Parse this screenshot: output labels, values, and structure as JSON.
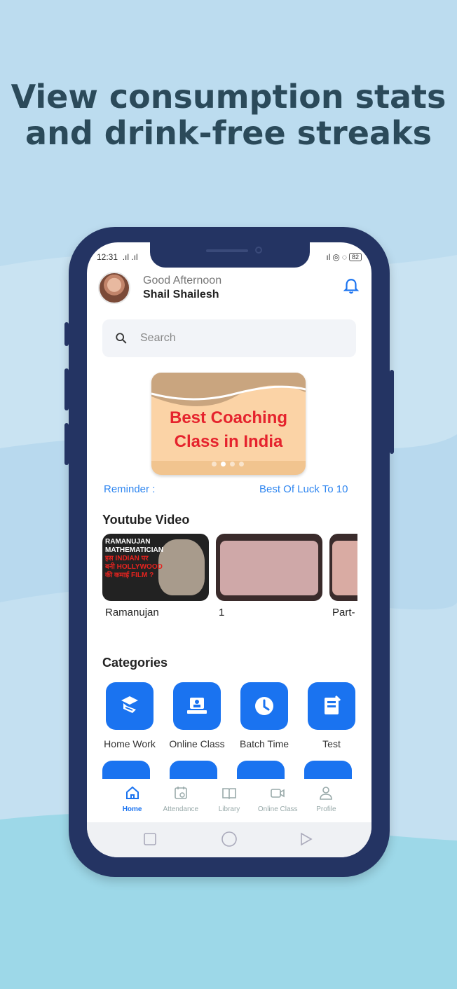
{
  "headline": [
    "View consumption stats",
    "and drink-free streaks"
  ],
  "status_bar": {
    "time": "12:31",
    "battery": "82"
  },
  "header": {
    "greeting": "Good Afternoon",
    "user_name": "Shail Shailesh",
    "avatar_icon": "user-avatar",
    "bell_icon": "bell-icon"
  },
  "search": {
    "placeholder": "Search"
  },
  "banner": {
    "line1": "Best Coaching",
    "line2": "Class in India",
    "dots": 4,
    "active_dot": 1
  },
  "reminder": {
    "label": "Reminder :",
    "message": "Best Of Luck To 10"
  },
  "youtube": {
    "title": "Youtube Video",
    "poster_lines": [
      "RAMANUJAN",
      "MATHEMATICIAN",
      "इस INDIAN पर",
      "बनी HOLLYWOOD",
      "की कमाई FILM ?"
    ],
    "videos": [
      "Ramanujan",
      "1",
      "Part-"
    ]
  },
  "categories": {
    "title": "Categories",
    "items": [
      "Home Work",
      "Online Class",
      "Batch Time",
      "Test"
    ]
  },
  "bottom_nav": {
    "items": [
      "Home",
      "Attendance",
      "Library",
      "Online Class",
      "Profile"
    ],
    "active": "Home"
  },
  "colors": {
    "accent": "#1a73f0",
    "phone_frame": "#243463",
    "headline": "#2b4a5a",
    "banner_text": "#e5232d"
  }
}
